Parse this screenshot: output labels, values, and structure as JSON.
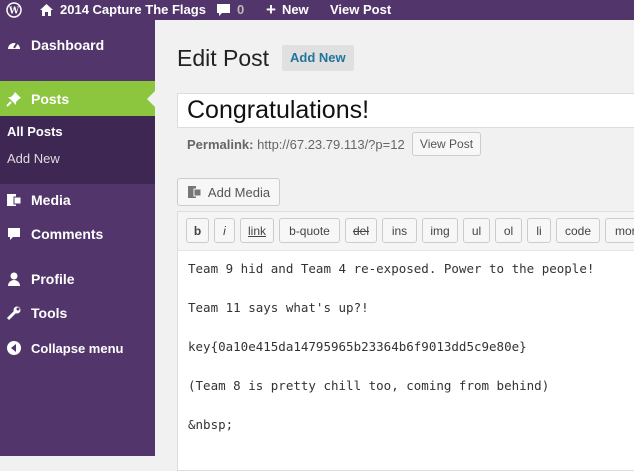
{
  "adminbar": {
    "site_name": "2014 Capture The Flags",
    "comments_count": "0",
    "new_label": "New",
    "view_post_label": "View Post"
  },
  "sidebar": {
    "dashboard": "Dashboard",
    "posts": "Posts",
    "submenu": [
      "All Posts",
      "Add New"
    ],
    "media": "Media",
    "comments": "Comments",
    "profile": "Profile",
    "tools": "Tools",
    "collapse": "Collapse menu"
  },
  "main": {
    "page_title": "Edit Post",
    "add_new": "Add New",
    "post_title": "Congratulations!",
    "permalink_label": "Permalink:",
    "permalink_url": "http://67.23.79.113/?p=12",
    "view_post_button": "View Post",
    "add_media": "Add Media"
  },
  "toolbar": {
    "buttons": [
      "b",
      "i",
      "link",
      "b-quote",
      "del",
      "ins",
      "img",
      "ul",
      "ol",
      "li",
      "code",
      "more"
    ]
  },
  "editor": {
    "lines": [
      "Team 9 hid and Team 4 re-exposed. Power to the people!",
      "Team 11 says what's up?!",
      "key{0a10e415da14795965b23364b6f9013dd5c9e80e}",
      "(Team 8 is pretty chill too, coming from behind)",
      "&nbsp;"
    ]
  },
  "colors": {
    "adminbar_bg": "#52366b",
    "sidebar_bg": "#52366b",
    "submenu_bg": "#3e2753",
    "active_menu_bg": "#8cc63f",
    "link_blue": "#21759b"
  }
}
